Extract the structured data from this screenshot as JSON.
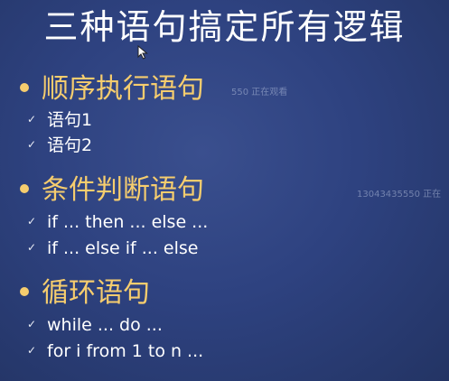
{
  "slide": {
    "title": "三种语句搞定所有逻辑",
    "sections": [
      {
        "heading": "顺序执行语句",
        "items": [
          "语句1",
          "语句2"
        ]
      },
      {
        "heading": "条件判断语句",
        "items": [
          "if ... then ... else ...",
          "if ... else if ... else"
        ]
      },
      {
        "heading": "循环语句",
        "items": [
          "while ... do ...",
          "for i from 1 to n ..."
        ]
      }
    ],
    "check_glyph": "✓",
    "watermarks": [
      "550 正在观看",
      "13043435550 正在"
    ]
  },
  "colors": {
    "background": "#2e4280",
    "title": "#ffffff",
    "heading": "#f6cd6e",
    "item": "#ffffff"
  }
}
